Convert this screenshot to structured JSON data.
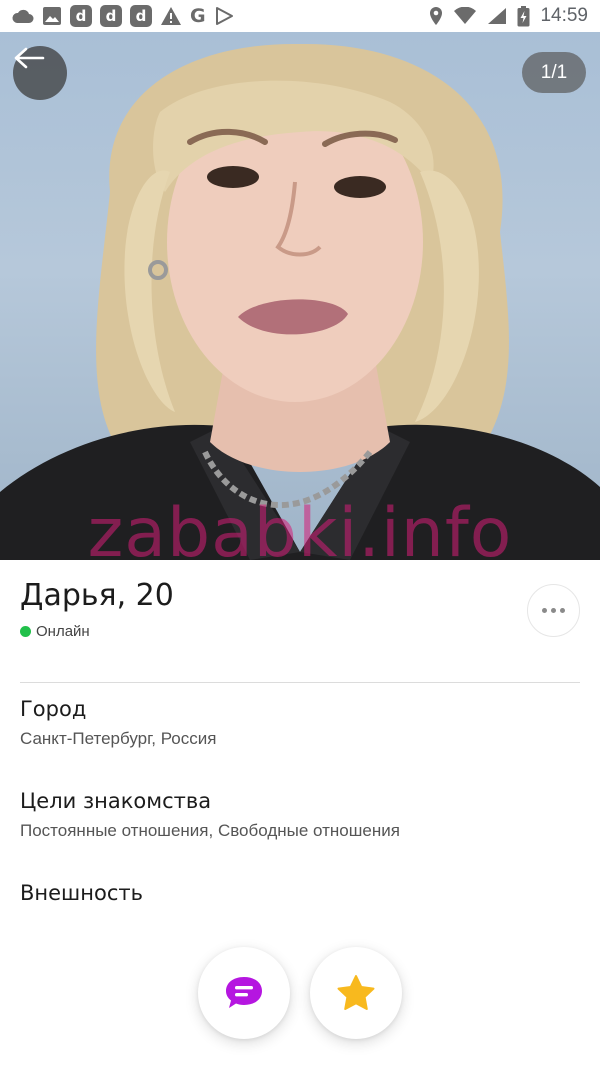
{
  "status_bar": {
    "time": "14:59",
    "left_icons": [
      "cloud-icon",
      "image-icon",
      "d-app-icon",
      "d-app-icon",
      "d-app-icon",
      "warning-icon",
      "g-icon",
      "play-icon"
    ],
    "right_icons": [
      "location-icon",
      "wifi-icon",
      "signal-icon",
      "battery-charging-icon"
    ],
    "g_glyph": "G",
    "d_glyph": "d"
  },
  "photo": {
    "counter": "1/1",
    "watermark": "zababki.info"
  },
  "profile": {
    "name_age": "Дарья, 20",
    "status": "Онлайн",
    "status_color": "#21c04a"
  },
  "sections": [
    {
      "title": "Город",
      "value": "Санкт-Петербург, Россия"
    },
    {
      "title": "Цели знакомства",
      "value": "Постоянные отношения, Свободные отношения"
    },
    {
      "title": "Внешность",
      "value": ""
    }
  ],
  "actions": {
    "message_color": "#b516e0",
    "favorite_color": "#f8b91e"
  }
}
